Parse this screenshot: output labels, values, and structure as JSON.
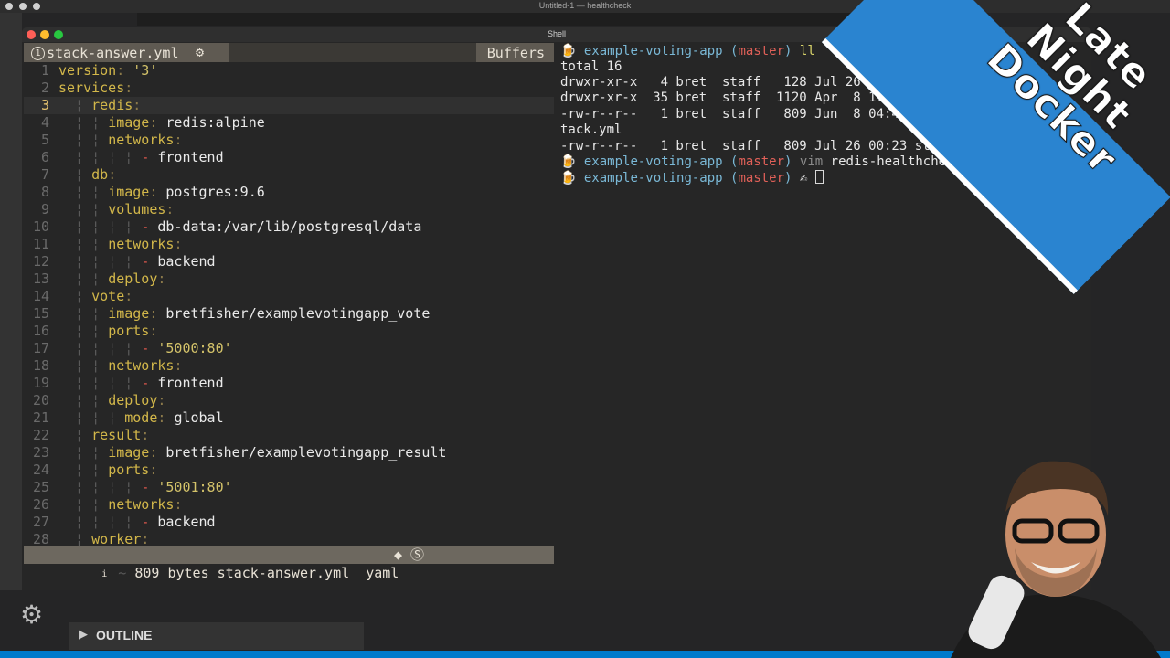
{
  "os": {
    "window_title": "Untitled-1 — healthcheck"
  },
  "terminal": {
    "title": "Shell"
  },
  "vim": {
    "tab_number": "1",
    "filename": "stack-answer.yml",
    "buffers_label": "Buffers",
    "lines": [
      {
        "n": "1",
        "indent": "",
        "key": "version",
        "val": "'3'",
        "type": "str"
      },
      {
        "n": "2",
        "indent": "",
        "key": "services",
        "val": "",
        "type": "key"
      },
      {
        "n": "3",
        "indent": "  ¦ ",
        "key": "redis",
        "val": "",
        "type": "key",
        "current": true
      },
      {
        "n": "4",
        "indent": "  ¦ ¦ ",
        "key": "image",
        "val": "redis:alpine",
        "type": "val"
      },
      {
        "n": "5",
        "indent": "  ¦ ¦ ",
        "key": "networks",
        "val": "",
        "type": "key"
      },
      {
        "n": "6",
        "indent": "  ¦ ¦ ¦ ¦ ",
        "key": "",
        "val": "frontend",
        "type": "item"
      },
      {
        "n": "7",
        "indent": "  ¦ ",
        "key": "db",
        "val": "",
        "type": "key"
      },
      {
        "n": "8",
        "indent": "  ¦ ¦ ",
        "key": "image",
        "val": "postgres:9.6",
        "type": "val"
      },
      {
        "n": "9",
        "indent": "  ¦ ¦ ",
        "key": "volumes",
        "val": "",
        "type": "key"
      },
      {
        "n": "10",
        "indent": "  ¦ ¦ ¦ ¦ ",
        "key": "",
        "val": "db-data:/var/lib/postgresql/data",
        "type": "item"
      },
      {
        "n": "11",
        "indent": "  ¦ ¦ ",
        "key": "networks",
        "val": "",
        "type": "key"
      },
      {
        "n": "12",
        "indent": "  ¦ ¦ ¦ ¦ ",
        "key": "",
        "val": "backend",
        "type": "item"
      },
      {
        "n": "13",
        "indent": "  ¦ ¦ ",
        "key": "deploy",
        "val": "",
        "type": "key"
      },
      {
        "n": "14",
        "indent": "  ¦ ",
        "key": "vote",
        "val": "",
        "type": "key"
      },
      {
        "n": "15",
        "indent": "  ¦ ¦ ",
        "key": "image",
        "val": "bretfisher/examplevotingapp_vote",
        "type": "val"
      },
      {
        "n": "16",
        "indent": "  ¦ ¦ ",
        "key": "ports",
        "val": "",
        "type": "key"
      },
      {
        "n": "17",
        "indent": "  ¦ ¦ ¦ ¦ ",
        "key": "",
        "val": "'5000:80'",
        "type": "itemstr"
      },
      {
        "n": "18",
        "indent": "  ¦ ¦ ",
        "key": "networks",
        "val": "",
        "type": "key"
      },
      {
        "n": "19",
        "indent": "  ¦ ¦ ¦ ¦ ",
        "key": "",
        "val": "frontend",
        "type": "item"
      },
      {
        "n": "20",
        "indent": "  ¦ ¦ ",
        "key": "deploy",
        "val": "",
        "type": "key"
      },
      {
        "n": "21",
        "indent": "  ¦ ¦ ¦ ",
        "key": "mode",
        "val": "global",
        "type": "val"
      },
      {
        "n": "22",
        "indent": "  ¦ ",
        "key": "result",
        "val": "",
        "type": "key"
      },
      {
        "n": "23",
        "indent": "  ¦ ¦ ",
        "key": "image",
        "val": "bretfisher/examplevotingapp_result",
        "type": "val"
      },
      {
        "n": "24",
        "indent": "  ¦ ¦ ",
        "key": "ports",
        "val": "",
        "type": "key"
      },
      {
        "n": "25",
        "indent": "  ¦ ¦ ¦ ¦ ",
        "key": "",
        "val": "'5001:80'",
        "type": "itemstr"
      },
      {
        "n": "26",
        "indent": "  ¦ ¦ ",
        "key": "networks",
        "val": "",
        "type": "key"
      },
      {
        "n": "27",
        "indent": "  ¦ ¦ ¦ ¦ ",
        "key": "",
        "val": "backend",
        "type": "item"
      },
      {
        "n": "28",
        "indent": "  ¦ ",
        "key": "worker",
        "val": "",
        "type": "key"
      }
    ],
    "status": {
      "info_icon": "i",
      "left": "809 bytes stack-answer.yml",
      "filetype": "yaml",
      "right_symbols": "◆ Ⓢ"
    }
  },
  "shell": {
    "prompt_dir": "example-voting-app",
    "prompt_branch": "master",
    "cmd1": "ll",
    "output": [
      "total 16",
      "drwxr-xr-x   4 bret  staff   128 Jul 26 00:23 .",
      "drwxr-xr-x  35 bret  staff  1120 Apr  8 17:12 ..",
      "-rw-r--r--   1 bret  staff   809 Jun  8 04:47 example-vot",
      "tack.yml",
      "-rw-r--r--   1 bret  staff   809 Jul 26 00:23 stack-answer.yml"
    ],
    "cmd2_prefix": "vim",
    "cmd2_arg": "redis-healthcheck",
    "cmd3_symbol": "✍"
  },
  "vscode": {
    "outline_label": "OUTLINE"
  },
  "overlay": {
    "banner_lines": [
      "Late",
      "Night",
      "Docker"
    ],
    "colors": {
      "banner": "#2a84d0",
      "status_strip": "#007acc"
    }
  }
}
